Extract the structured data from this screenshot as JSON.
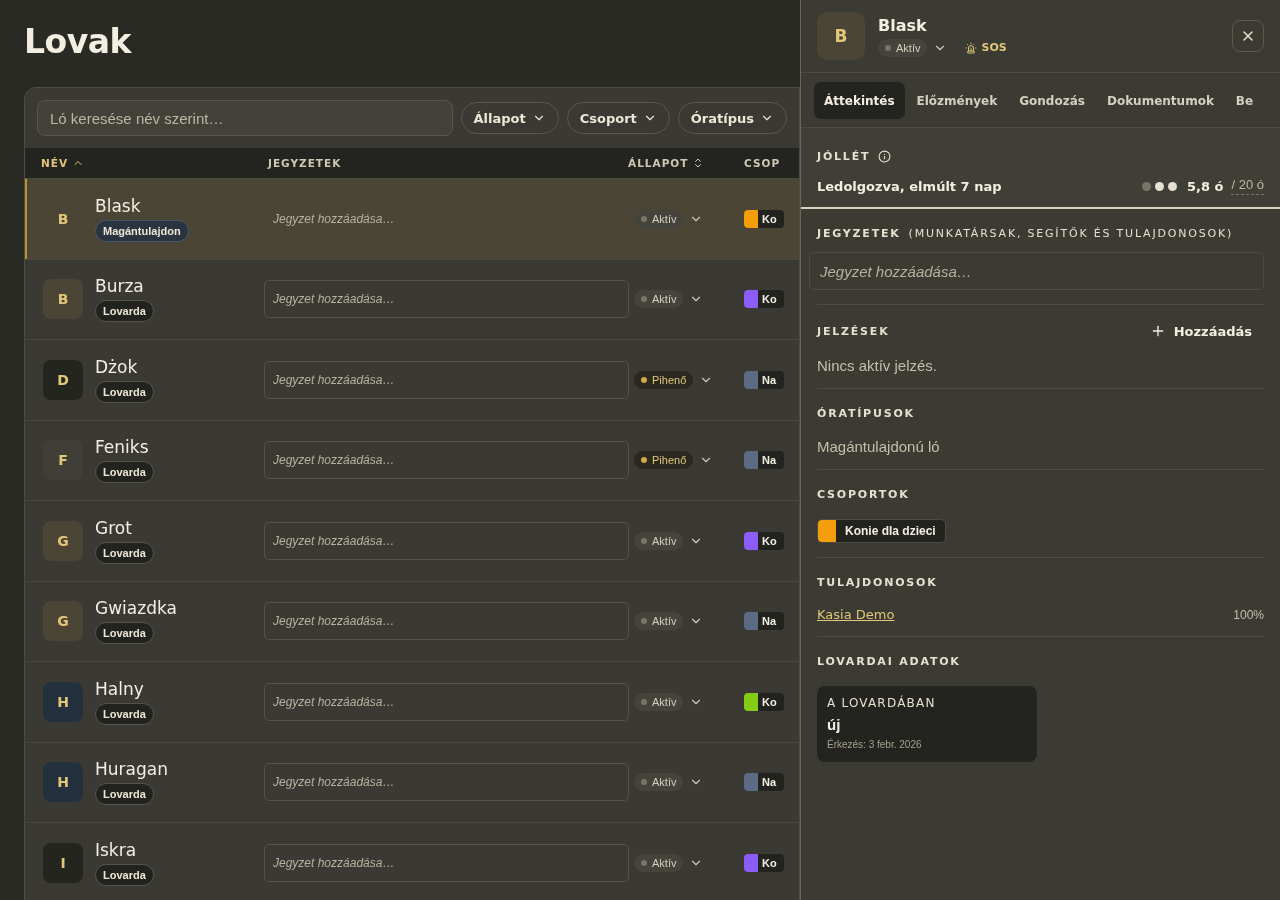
{
  "page": {
    "title": "Lovak"
  },
  "filters": {
    "search_placeholder": "Ló keresése név szerint…",
    "dropdowns": [
      "Állapot",
      "Csoport",
      "Óratípus"
    ]
  },
  "table": {
    "columns": [
      {
        "label": "NÉV",
        "sorted": true
      },
      {
        "label": "JEGYZETEK",
        "sorted": false
      },
      {
        "label": "ÁLLAPOT",
        "sorted": false
      },
      {
        "label": "CSOP",
        "sorted": false
      }
    ],
    "rows": [
      {
        "initial": "B",
        "name": "Blask",
        "color": "#4a4535",
        "tag": {
          "label": "Magántulajdon",
          "kind": "private"
        },
        "note_placeholder": "Jegyzet hozzáadása…",
        "status": {
          "label": "Aktív",
          "kind": "active"
        },
        "group": {
          "label": "Ko",
          "color": "#f59e0b"
        },
        "selected": true
      },
      {
        "initial": "B",
        "name": "Burza",
        "color": "#4a4535",
        "tag": {
          "label": "Lovarda",
          "kind": "stable"
        },
        "note_placeholder": "Jegyzet hozzáadása…",
        "status": {
          "label": "Aktív",
          "kind": "active"
        },
        "group": {
          "label": "Ko",
          "color": "#8b5cf6"
        },
        "selected": false
      },
      {
        "initial": "D",
        "name": "Dżok",
        "color": "#25251f",
        "tag": {
          "label": "Lovarda",
          "kind": "stable"
        },
        "note_placeholder": "Jegyzet hozzáadása…",
        "status": {
          "label": "Pihenő",
          "kind": "resting"
        },
        "group": {
          "label": "Na",
          "color": "#5b6b85"
        },
        "selected": false
      },
      {
        "initial": "F",
        "name": "Feniks",
        "color": "#403f37",
        "tag": {
          "label": "Lovarda",
          "kind": "stable"
        },
        "note_placeholder": "Jegyzet hozzáadása…",
        "status": {
          "label": "Pihenő",
          "kind": "resting"
        },
        "group": {
          "label": "Na",
          "color": "#5b6b85"
        },
        "selected": false
      },
      {
        "initial": "G",
        "name": "Grot",
        "color": "#4a4535",
        "tag": {
          "label": "Lovarda",
          "kind": "stable"
        },
        "note_placeholder": "Jegyzet hozzáadása…",
        "status": {
          "label": "Aktív",
          "kind": "active"
        },
        "group": {
          "label": "Ko",
          "color": "#8b5cf6"
        },
        "selected": false
      },
      {
        "initial": "G",
        "name": "Gwiazdka",
        "color": "#4a4535",
        "tag": {
          "label": "Lovarda",
          "kind": "stable"
        },
        "note_placeholder": "Jegyzet hozzáadása…",
        "status": {
          "label": "Aktív",
          "kind": "active"
        },
        "group": {
          "label": "Na",
          "color": "#5b6b85"
        },
        "selected": false
      },
      {
        "initial": "H",
        "name": "Halny",
        "color": "#23303d",
        "tag": {
          "label": "Lovarda",
          "kind": "stable"
        },
        "note_placeholder": "Jegyzet hozzáadása…",
        "status": {
          "label": "Aktív",
          "kind": "active"
        },
        "group": {
          "label": "Ko",
          "color": "#84cc16"
        },
        "selected": false
      },
      {
        "initial": "H",
        "name": "Huragan",
        "color": "#23303d",
        "tag": {
          "label": "Lovarda",
          "kind": "stable"
        },
        "note_placeholder": "Jegyzet hozzáadása…",
        "status": {
          "label": "Aktív",
          "kind": "active"
        },
        "group": {
          "label": "Na",
          "color": "#5b6b85"
        },
        "selected": false
      },
      {
        "initial": "I",
        "name": "Iskra",
        "color": "#25251f",
        "tag": {
          "label": "Lovarda",
          "kind": "stable"
        },
        "note_placeholder": "Jegyzet hozzáadása…",
        "status": {
          "label": "Aktív",
          "kind": "active"
        },
        "group": {
          "label": "Ko",
          "color": "#8b5cf6"
        },
        "selected": false
      }
    ]
  },
  "panel": {
    "initial": "B",
    "name": "Blask",
    "status": {
      "label": "Aktív",
      "kind": "active"
    },
    "sos": "SOS",
    "tabs": [
      {
        "label": "Áttekintés",
        "selected": true
      },
      {
        "label": "Előzmények",
        "selected": false
      },
      {
        "label": "Gondozás",
        "selected": false
      },
      {
        "label": "Dokumentumok",
        "selected": false
      },
      {
        "label": "Be",
        "selected": false
      }
    ],
    "wellbeing": {
      "title": "JÓLLÉT",
      "label": "Ledolgozva, elmúlt 7 nap",
      "stars": 2,
      "value": "5,8 ó",
      "limit": "/ 20 ó"
    },
    "notes": {
      "title": "JEGYZETEK",
      "subtitle": "(MUNKATÁRSAK, SEGÍTŐK ÉS TULAJDONOSOK)",
      "placeholder": "Jegyzet hozzáadása…"
    },
    "signals": {
      "title": "JELZÉSEK",
      "add": "Hozzáadás",
      "empty": "Nincs aktív jelzés."
    },
    "lesson_types": {
      "title": "ÓRATÍPUSOK",
      "value": "Magántulajdonú ló"
    },
    "groups": {
      "title": "CSOPORTOK",
      "items": [
        {
          "label": "Konie dla dzieci",
          "color": "#f59e0b"
        }
      ]
    },
    "owners": {
      "title": "TULAJDONOSOK",
      "items": [
        {
          "name": "Kasia Demo",
          "share": "100%"
        }
      ]
    },
    "stable_data": {
      "title": "LOVARDAI ADATOK",
      "card": {
        "title": "A LOVARDÁBAN",
        "value": "új",
        "note": "Érkezés: 3 febr. 2026"
      }
    }
  }
}
